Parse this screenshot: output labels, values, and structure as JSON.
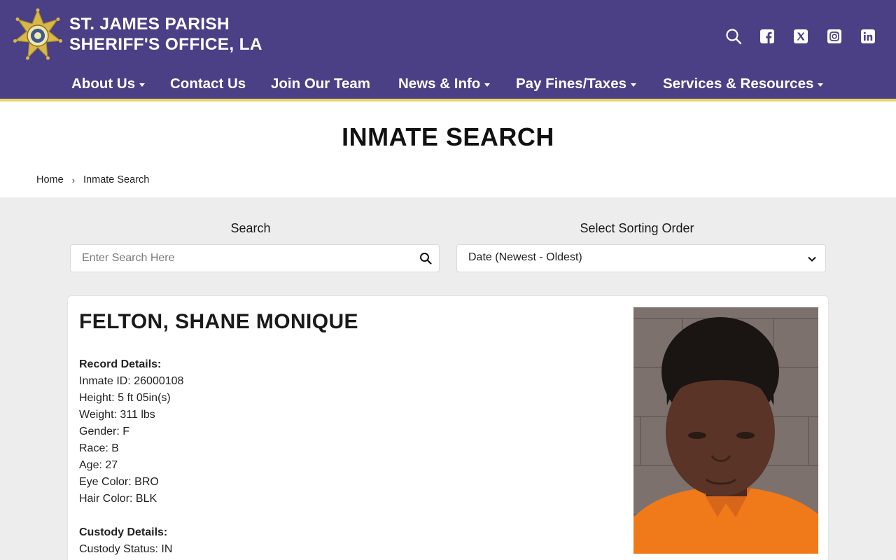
{
  "site": {
    "brand_line1": "ST. JAMES PARISH",
    "brand_line2": "SHERIFF'S OFFICE, LA",
    "header_color": "#4b3f86",
    "accent_color": "#e8d56a"
  },
  "social_icons": [
    "search-icon",
    "facebook-icon",
    "x-icon",
    "instagram-icon",
    "linkedin-icon"
  ],
  "nav": {
    "items": [
      {
        "label": "About Us",
        "has_dropdown": true
      },
      {
        "label": "Contact Us",
        "has_dropdown": false
      },
      {
        "label": "Join Our Team",
        "has_dropdown": false
      },
      {
        "label": "News & Info",
        "has_dropdown": true
      },
      {
        "label": "Pay Fines/Taxes",
        "has_dropdown": true
      },
      {
        "label": "Services & Resources",
        "has_dropdown": true
      }
    ]
  },
  "page": {
    "title": "INMATE SEARCH",
    "breadcrumb": [
      "Home",
      "Inmate Search"
    ]
  },
  "search": {
    "label": "Search",
    "placeholder": "Enter Search Here",
    "value": ""
  },
  "sort": {
    "label": "Select Sorting Order",
    "selected": "Date (Newest - Oldest)"
  },
  "inmate": {
    "name": "FELTON, SHANE MONIQUE",
    "record_heading": "Record Details:",
    "record": [
      "Inmate ID: 26000108",
      "Height: 5 ft 05in(s)",
      "Weight: 311 lbs",
      "Gender: F",
      "Race: B",
      "Age: 27",
      "Eye Color: BRO",
      "Hair Color: BLK"
    ],
    "custody_heading": "Custody Details:",
    "custody": [
      "Custody Status: IN"
    ]
  }
}
